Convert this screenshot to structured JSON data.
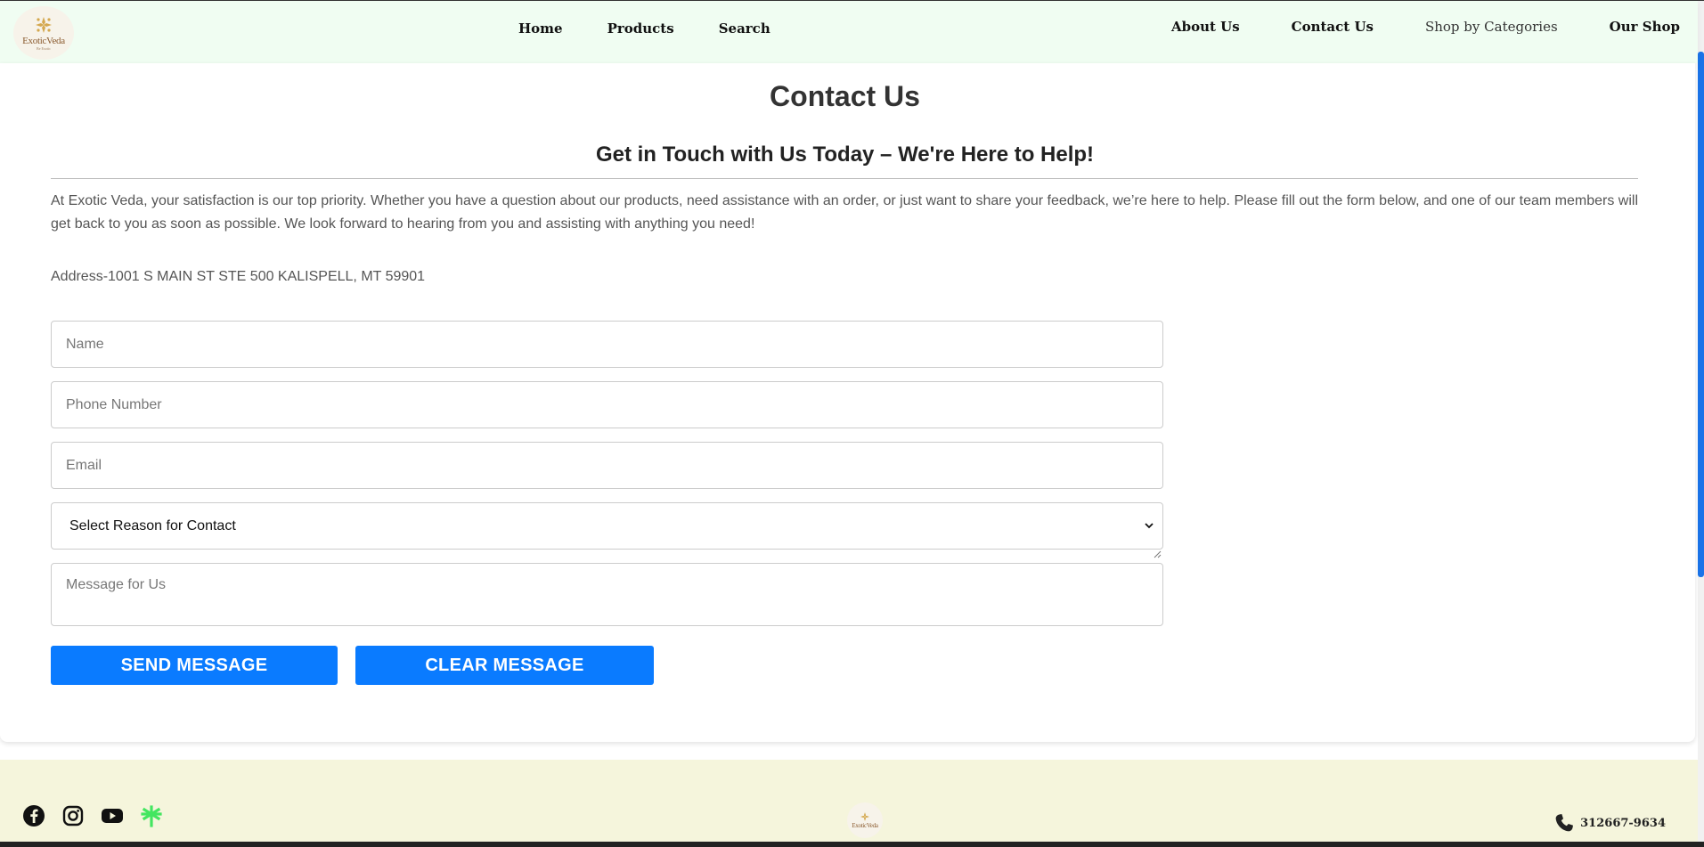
{
  "brand": {
    "logo_text": "ExoticVeda",
    "logo_subtext": "Be Exotic"
  },
  "nav": {
    "center": [
      "Home",
      "Products",
      "Search"
    ],
    "right": [
      "About Us",
      "Contact Us",
      "Shop by Categories",
      "Our Shop"
    ]
  },
  "page": {
    "title": "Contact Us",
    "subtitle": "Get in Touch with Us Today – We're Here to Help!",
    "intro": "At Exotic Veda, your satisfaction is our top priority. Whether you have a question about our products, need assistance with an order, or just want to share your feedback, we’re here to help. Please fill out the form below, and one of our team members will get back to you as soon as possible. We look forward to hearing from you and assisting with anything you need!",
    "address": "Address-1001 S MAIN ST STE 500 KALISPELL, MT 59901"
  },
  "form": {
    "name_placeholder": "Name",
    "phone_placeholder": "Phone Number",
    "email_placeholder": "Email",
    "reason_selected": "Select Reason for Contact",
    "message_placeholder": "Message for Us",
    "send_label": "SEND MESSAGE",
    "clear_label": "CLEAR MESSAGE"
  },
  "footer": {
    "social": [
      "facebook-icon",
      "instagram-icon",
      "youtube-icon",
      "linktree-icon"
    ],
    "phone": "312667-9634"
  },
  "colors": {
    "header_bg": "#f0fdf2",
    "footer_bg": "#f5f5dc",
    "button": "#0a7bff",
    "scrollbar": "#1a73e8",
    "linktree": "#43e660"
  }
}
